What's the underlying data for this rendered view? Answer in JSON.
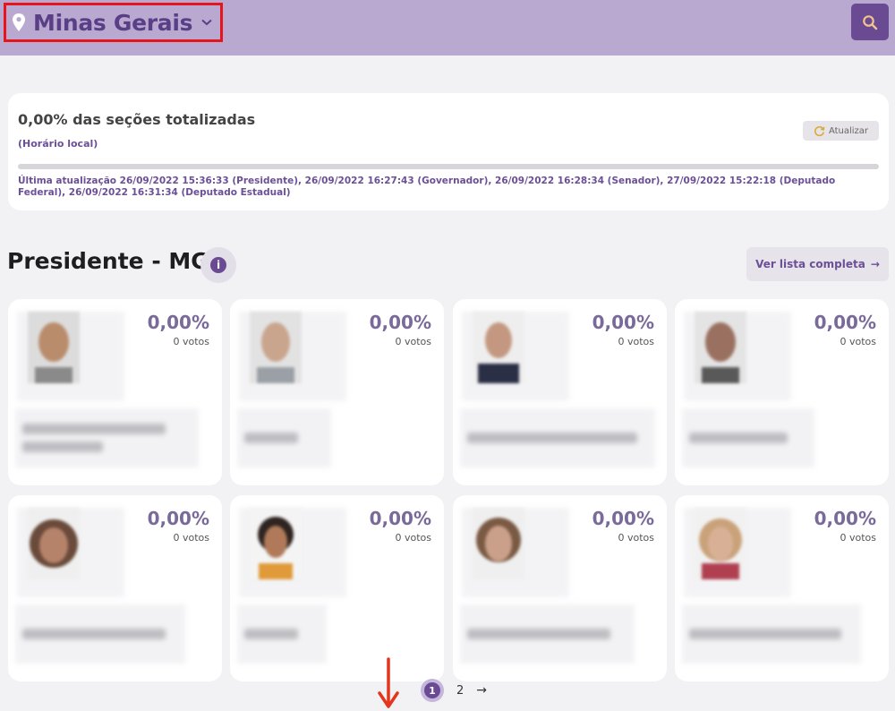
{
  "header": {
    "location": "Minas Gerais",
    "icons": {
      "location": "map-pin-icon",
      "dropdown": "chevron-down-icon",
      "search": "search-icon"
    }
  },
  "status": {
    "title": "0,00% das seções totalizadas",
    "local_time_label": "(Horário local)",
    "refresh_label": "Atualizar",
    "progress_percent": 0,
    "last_update": "Última atualização 26/09/2022 15:36:33 (Presidente), 26/09/2022 16:27:43 (Governador), 26/09/2022 16:28:34 (Senador), 27/09/2022 15:22:18 (Deputado Federal), 26/09/2022 16:31:34 (Deputado Estadual)"
  },
  "section": {
    "title": "Presidente - MG",
    "full_list_label": "Ver lista completa",
    "full_list_arrow": "→"
  },
  "candidates": [
    {
      "percent": "0,00%",
      "votes": "0 votos"
    },
    {
      "percent": "0,00%",
      "votes": "0 votos"
    },
    {
      "percent": "0,00%",
      "votes": "0 votos"
    },
    {
      "percent": "0,00%",
      "votes": "0 votos"
    },
    {
      "percent": "0,00%",
      "votes": "0 votos"
    },
    {
      "percent": "0,00%",
      "votes": "0 votos"
    },
    {
      "percent": "0,00%",
      "votes": "0 votos"
    },
    {
      "percent": "0,00%",
      "votes": "0 votos"
    }
  ],
  "pagination": {
    "page1": "1",
    "page2": "2",
    "next": "→"
  },
  "colors": {
    "header_bg": "#b9a9d1",
    "accent": "#6a4b93",
    "highlight_box": "#e8141c",
    "annotation_arrow": "#e4351e"
  }
}
